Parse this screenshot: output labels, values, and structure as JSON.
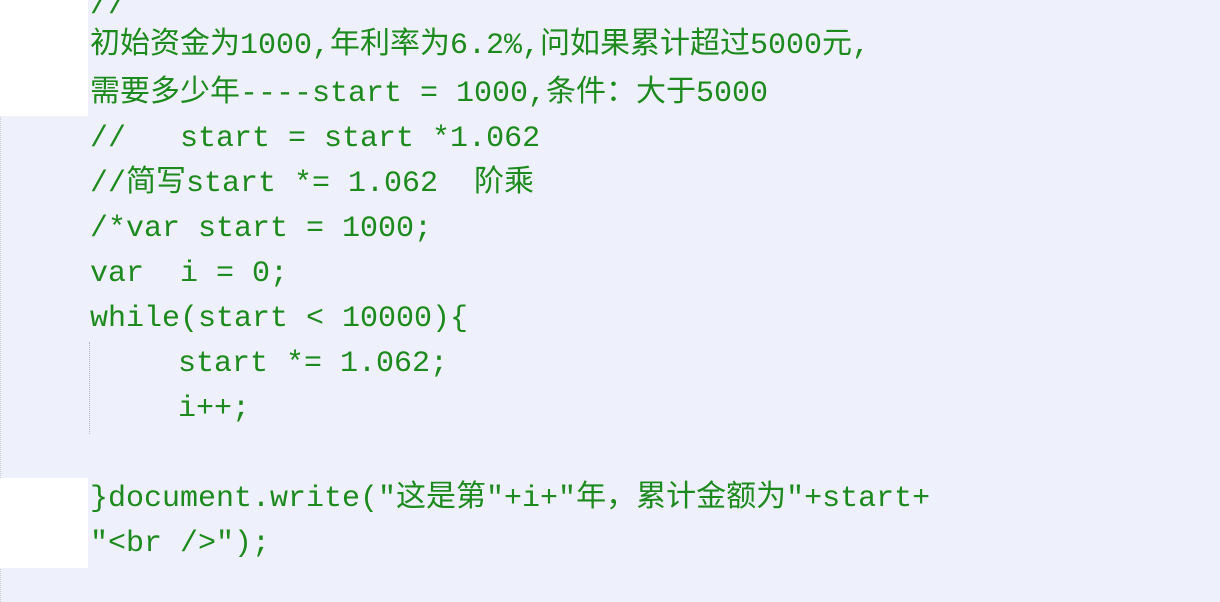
{
  "editor": {
    "lines": [
      "//",
      "初始资金为1000,年利率为6.2%,问如果累计超过5000元,",
      "需要多少年----start = 1000,条件：大于5000",
      "//   start = start *1.062",
      "//简写start *= 1.062  阶乘",
      "/*var start = 1000;",
      "var  i = 0;",
      "while(start < 10000){",
      "start *= 1.062;",
      "i++;",
      "}document.write(\"这是第\"+i+\"年，累计金额为\"+start+",
      "\"<br />\");"
    ]
  }
}
